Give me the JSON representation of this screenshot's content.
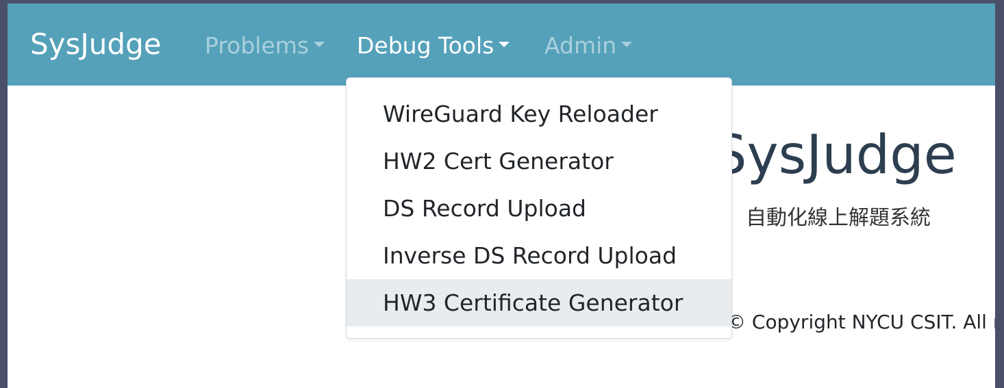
{
  "navbar": {
    "brand": "SysJudge",
    "items": [
      {
        "label": "Problems",
        "active": false
      },
      {
        "label": "Debug Tools",
        "active": true
      },
      {
        "label": "Admin",
        "active": false
      }
    ],
    "colors": {
      "background": "#55a1ba",
      "muted_text": "#a9d0dd",
      "active_text": "#ffffff"
    }
  },
  "dropdown": {
    "items": [
      {
        "label": "WireGuard Key Reloader"
      },
      {
        "label": "HW2 Cert Generator"
      },
      {
        "label": "DS Record Upload"
      },
      {
        "label": "Inverse DS Record Upload"
      },
      {
        "label": "HW3 Certificate Generator",
        "highlighted": true
      }
    ]
  },
  "hero": {
    "title": "SysJudge",
    "subtitle": "自動化線上解題系統"
  },
  "footer": {
    "text": "© Copyright NYCU CSIT. All rights reserved."
  }
}
